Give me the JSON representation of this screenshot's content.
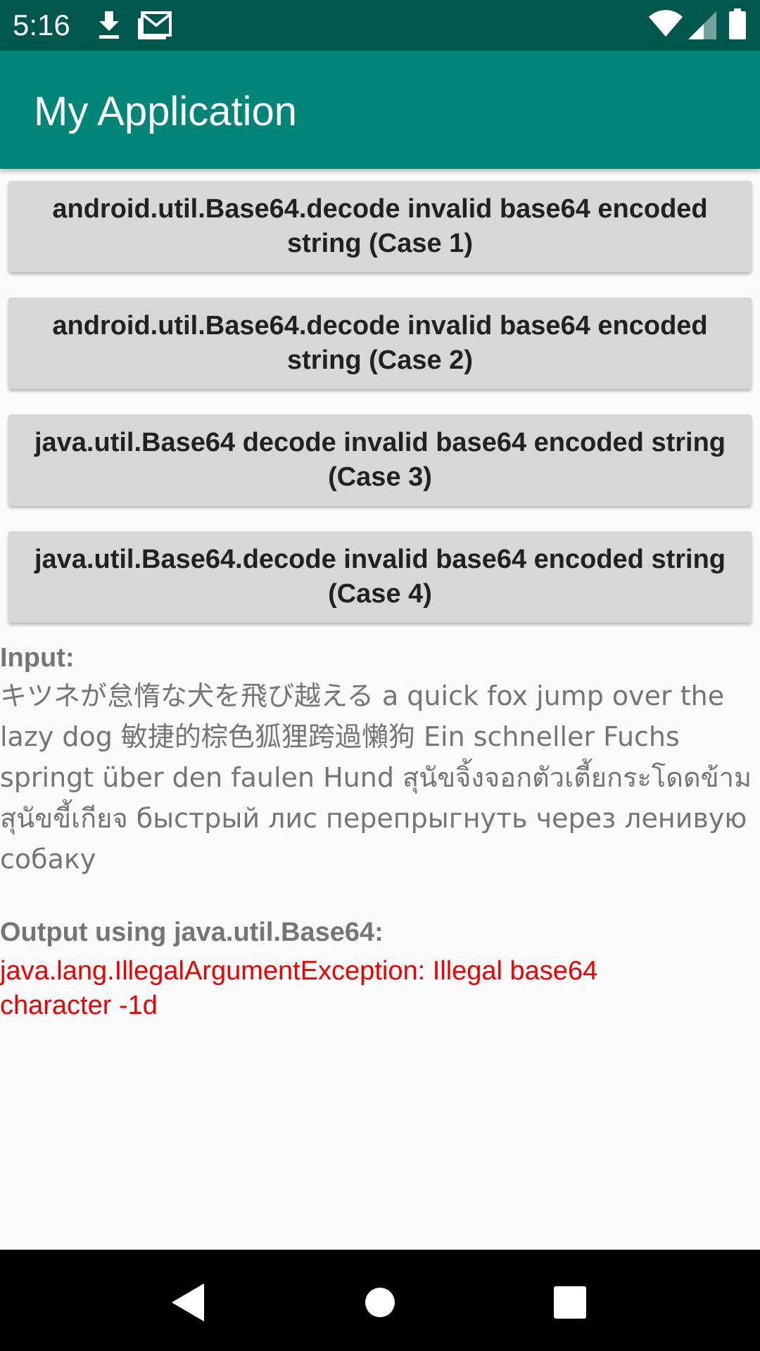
{
  "status_bar": {
    "time": "5:16",
    "icons": [
      "download-icon",
      "gmail-icon",
      "wifi-icon",
      "cell-signal-icon",
      "battery-icon"
    ]
  },
  "app_bar": {
    "title": "My Application",
    "color": "#008577"
  },
  "buttons": [
    {
      "label": "android.util.Base64.decode invalid base64 encoded string (Case 1)"
    },
    {
      "label": "android.util.Base64.decode invalid base64 encoded string (Case 2)"
    },
    {
      "label": "java.util.Base64 decode invalid base64 encoded string (Case 3)"
    },
    {
      "label": "java.util.Base64.decode invalid base64 encoded string (Case 4)"
    }
  ],
  "input": {
    "label": "Input:",
    "text": "キツネが怠惰な犬を飛び越える a quick fox jump over the lazy dog 敏捷的棕色狐狸跨過懶狗 Ein schneller Fuchs springt über den faulen Hund สุนัขจิ้งจอกตัวเตี้ยกระโดดข้ามสุนัขขี้เกียจ быстрый лис перепрыгнуть через ленивую собаку"
  },
  "output": {
    "label": "Output using java.util.Base64:",
    "text": "java.lang.IllegalArgumentException: Illegal base64 character -1d",
    "color": "#ee0000"
  },
  "nav_bar": {
    "buttons": [
      "back-icon",
      "home-icon",
      "recents-icon"
    ]
  }
}
